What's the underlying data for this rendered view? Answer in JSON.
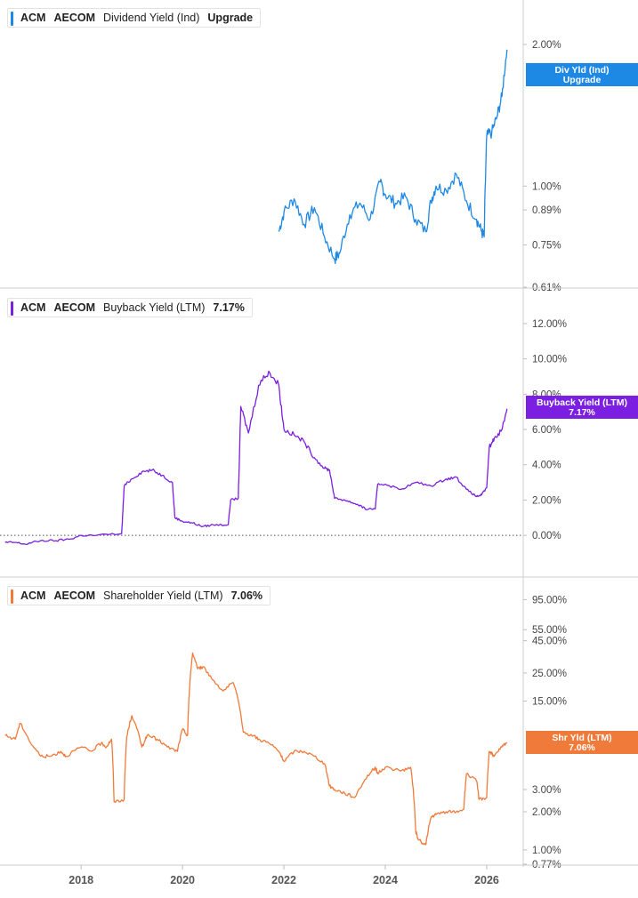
{
  "chart_data": [
    {
      "type": "line",
      "ticker": "ACM",
      "company": "AECOM",
      "metric": "Dividend Yield (Ind)",
      "value_label": "Upgrade",
      "tag_line1": "Div Yld (Ind)",
      "tag_line2": "Upgrade",
      "color": "#1e88e5",
      "scale": "log",
      "ylim": [
        0.61,
        2.4
      ],
      "yticks": [
        {
          "label": "2.00%",
          "v": 2.0
        },
        {
          "label": "1.00%",
          "v": 1.0
        },
        {
          "label": "0.89%",
          "v": 0.89
        },
        {
          "label": "0.75%",
          "v": 0.75
        },
        {
          "label": "0.61%",
          "v": 0.61
        }
      ],
      "series": [
        {
          "x": [
            2021.9,
            2022.0,
            2022.2,
            2022.4,
            2022.6,
            2022.8,
            2023.0,
            2023.1,
            2023.3,
            2023.5,
            2023.7,
            2023.9,
            2024.0,
            2024.2,
            2024.4,
            2024.6,
            2024.8,
            2024.9,
            2025.0,
            2025.2,
            2025.4,
            2025.6,
            2025.8,
            2025.9,
            2025.95,
            2026.0,
            2026.1,
            2026.2,
            2026.3,
            2026.4
          ],
          "y": [
            0.8,
            0.88,
            0.94,
            0.83,
            0.9,
            0.78,
            0.7,
            0.72,
            0.87,
            0.92,
            0.85,
            1.02,
            0.96,
            0.92,
            0.95,
            0.85,
            0.8,
            0.93,
            1.0,
            0.98,
            1.06,
            0.93,
            0.85,
            0.8,
            0.78,
            1.28,
            1.3,
            1.4,
            1.55,
            1.95
          ]
        }
      ]
    },
    {
      "type": "line",
      "ticker": "ACM",
      "company": "AECOM",
      "metric": "Buyback Yield (LTM)",
      "value_label": "7.17%",
      "tag_line1": "Buyback Yield (LTM)",
      "tag_line2": "7.17%",
      "color": "#7b1fe0",
      "scale": "linear",
      "ylim": [
        -1.0,
        12.6
      ],
      "yticks": [
        {
          "label": "12.00%",
          "v": 12
        },
        {
          "label": "10.00%",
          "v": 10
        },
        {
          "label": "8.00%",
          "v": 8
        },
        {
          "label": "6.00%",
          "v": 6
        },
        {
          "label": "4.00%",
          "v": 4
        },
        {
          "label": "2.00%",
          "v": 2
        },
        {
          "label": "0.00%",
          "v": 0
        }
      ],
      "series": [
        {
          "x": [
            2016.5,
            2016.7,
            2016.9,
            2017.2,
            2017.5,
            2017.8,
            2018.0,
            2018.3,
            2018.8,
            2018.85,
            2019.0,
            2019.2,
            2019.4,
            2019.6,
            2019.8,
            2019.85,
            2020.0,
            2020.2,
            2020.4,
            2020.6,
            2020.9,
            2020.95,
            2021.1,
            2021.15,
            2021.3,
            2021.5,
            2021.7,
            2021.9,
            2022.0,
            2022.2,
            2022.4,
            2022.6,
            2022.8,
            2022.9,
            2023.0,
            2023.2,
            2023.4,
            2023.5,
            2023.6,
            2023.8,
            2023.85,
            2024.0,
            2024.3,
            2024.6,
            2024.9,
            2025.2,
            2025.4,
            2025.6,
            2025.8,
            2025.9,
            2026.0,
            2026.05,
            2026.15,
            2026.3,
            2026.4
          ],
          "y": [
            -0.4,
            -0.4,
            -0.5,
            -0.3,
            -0.3,
            -0.2,
            0.0,
            0.0,
            0.1,
            2.8,
            3.2,
            3.6,
            3.7,
            3.4,
            3.0,
            1.0,
            0.8,
            0.7,
            0.5,
            0.6,
            0.6,
            2.0,
            2.1,
            7.3,
            5.8,
            8.5,
            9.3,
            8.5,
            6.0,
            5.7,
            5.3,
            4.4,
            3.8,
            3.7,
            2.1,
            2.0,
            1.8,
            1.7,
            1.5,
            1.5,
            2.9,
            2.9,
            2.6,
            3.0,
            2.8,
            3.2,
            3.3,
            2.6,
            2.2,
            2.3,
            2.7,
            5.0,
            5.5,
            6.0,
            7.17
          ]
        }
      ]
    },
    {
      "type": "line",
      "ticker": "ACM",
      "company": "AECOM",
      "metric": "Shareholder Yield (LTM)",
      "value_label": "7.06%",
      "tag_line1": "Shr Yld (LTM)",
      "tag_line2": "7.06%",
      "color": "#f07a3a",
      "scale": "log",
      "ylim": [
        0.77,
        120
      ],
      "yticks": [
        {
          "label": "95.00%",
          "v": 95
        },
        {
          "label": "55.00%",
          "v": 55
        },
        {
          "label": "45.00%",
          "v": 45
        },
        {
          "label": "25.00%",
          "v": 25
        },
        {
          "label": "15.00%",
          "v": 15
        },
        {
          "label": "3.00%",
          "v": 3
        },
        {
          "label": "2.00%",
          "v": 2
        },
        {
          "label": "1.00%",
          "v": 1
        },
        {
          "label": "0.77%",
          "v": 0.77
        }
      ],
      "series": [
        {
          "x": [
            2016.5,
            2016.7,
            2016.8,
            2017.0,
            2017.2,
            2017.4,
            2017.6,
            2017.7,
            2018.0,
            2018.2,
            2018.4,
            2018.5,
            2018.6,
            2018.65,
            2018.85,
            2018.9,
            2019.0,
            2019.2,
            2019.3,
            2019.5,
            2019.7,
            2019.9,
            2020.0,
            2020.1,
            2020.2,
            2020.3,
            2020.4,
            2020.6,
            2020.8,
            2021.0,
            2021.2,
            2021.4,
            2021.5,
            2021.7,
            2021.9,
            2022.0,
            2022.2,
            2022.4,
            2022.6,
            2022.8,
            2022.9,
            2023.0,
            2023.2,
            2023.4,
            2023.6,
            2023.8,
            2023.85,
            2024.0,
            2024.3,
            2024.5,
            2024.6,
            2024.65,
            2024.8,
            2024.9,
            2025.0,
            2025.2,
            2025.4,
            2025.55,
            2025.6,
            2025.8,
            2025.85,
            2026.0,
            2026.05,
            2026.15,
            2026.3,
            2026.4
          ],
          "y": [
            8.0,
            7.5,
            10.0,
            7.0,
            5.5,
            5.5,
            6.0,
            5.5,
            6.5,
            6.0,
            7.0,
            6.5,
            7.5,
            2.4,
            2.5,
            7.8,
            11.5,
            6.5,
            8.0,
            7.5,
            6.5,
            6.0,
            9.0,
            8.0,
            36.0,
            27.0,
            28.0,
            22.0,
            18.0,
            21.0,
            8.5,
            8.0,
            7.5,
            7.0,
            6.0,
            5.0,
            6.0,
            6.0,
            5.5,
            4.8,
            3.2,
            3.0,
            2.8,
            2.6,
            3.6,
            4.5,
            4.0,
            4.5,
            4.2,
            4.5,
            1.4,
            1.2,
            1.1,
            1.8,
            1.9,
            2.0,
            2.0,
            2.1,
            4.0,
            3.5,
            2.5,
            2.6,
            6.0,
            5.5,
            6.5,
            7.06
          ]
        }
      ]
    }
  ],
  "x_axis": {
    "labels": [
      {
        "label": "2018",
        "v": 2018
      },
      {
        "label": "2020",
        "v": 2020
      },
      {
        "label": "2022",
        "v": 2022
      },
      {
        "label": "2024",
        "v": 2024
      },
      {
        "label": "2026",
        "v": 2026
      }
    ],
    "range": [
      2016.4,
      2026.72
    ]
  },
  "zero_line_value": 0
}
